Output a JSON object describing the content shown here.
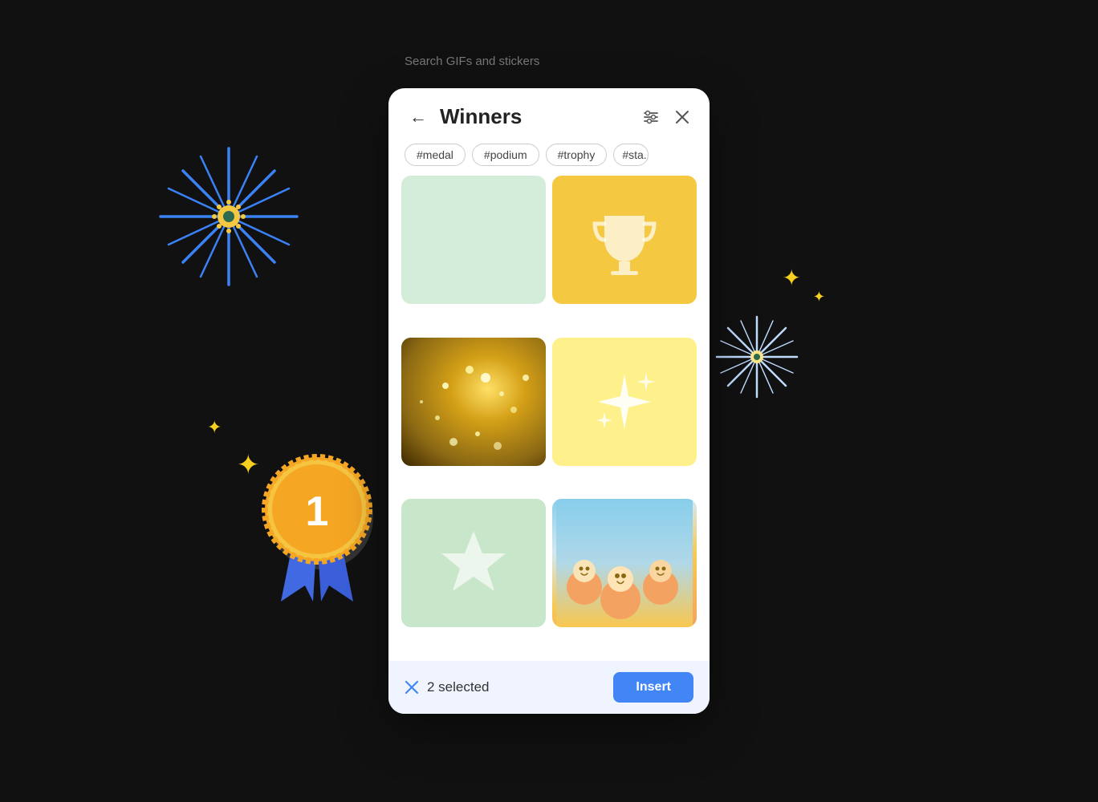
{
  "background": {
    "color": "#111111"
  },
  "search_label": "Search GIFs and stickers",
  "header": {
    "back_label": "←",
    "title": "Winners",
    "filter_icon": "filter-icon",
    "close_icon": "close-icon"
  },
  "tags": [
    {
      "label": "#medal"
    },
    {
      "label": "#podium"
    },
    {
      "label": "#trophy"
    },
    {
      "label": "#sta..."
    }
  ],
  "grid_items": [
    {
      "type": "green-light",
      "alt": "green background"
    },
    {
      "type": "yellow-trophy",
      "alt": "trophy cup"
    },
    {
      "type": "gold-glitter",
      "alt": "gold glitter"
    },
    {
      "type": "yellow-sparkle",
      "alt": "sparkles"
    },
    {
      "type": "green-star",
      "alt": "star on green"
    },
    {
      "type": "team-photo",
      "alt": "team celebration"
    }
  ],
  "bottom_bar": {
    "selected_count": "2 selected",
    "insert_label": "Insert",
    "x_label": "×"
  },
  "decorations": {
    "sparkle_color": "#f5d020",
    "blue_starburst_color": "#3b82f6",
    "light_blue_color": "#93c5fd"
  }
}
